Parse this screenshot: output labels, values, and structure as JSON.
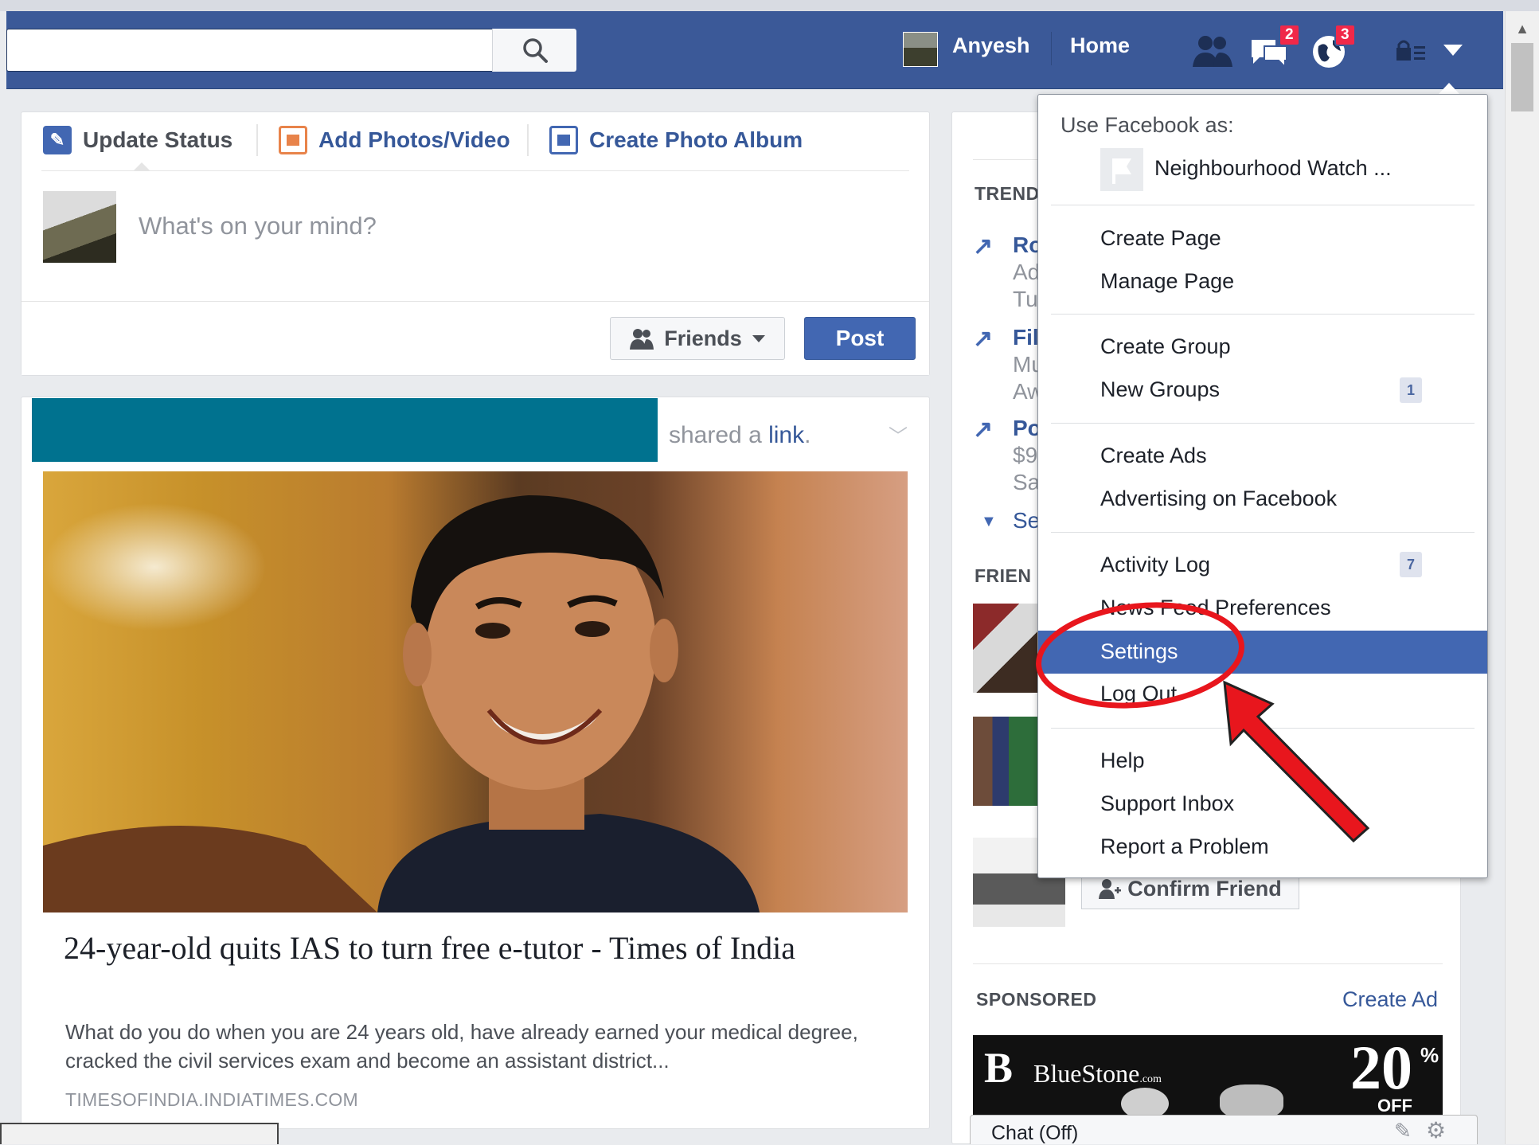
{
  "header": {
    "user_name": "Anyesh",
    "home_label": "Home",
    "notifications": {
      "messages_count": "2",
      "global_count": "3"
    }
  },
  "composer": {
    "tabs": [
      "Update Status",
      "Add Photos/Video",
      "Create Photo Album"
    ],
    "placeholder": "What's on your mind?",
    "audience_label": "Friends",
    "post_label": "Post"
  },
  "story": {
    "shared_prefix": "shared a ",
    "shared_link": "link",
    "shared_suffix": ".",
    "title": "24-year-old quits IAS to turn free e-tutor - Times of India",
    "description": "What do you do when you are 24 years old, have already earned your medical degree, cracked the civil services exam and become an assistant district...",
    "domain": "TIMESOFINDIA.INDIATIMES.COM"
  },
  "right": {
    "trending_heading": "TREND",
    "trends": [
      {
        "title": "Ro",
        "sub1": "Ad",
        "sub2": "Tu"
      },
      {
        "title": "Fil",
        "sub1": "Mu",
        "sub2": "Aw"
      },
      {
        "title": "Po",
        "sub1": "$9",
        "sub2": "Sa"
      }
    ],
    "see_more": "Se",
    "friends_heading": "FRIEN",
    "confirm_label": "Confirm Friend",
    "sponsored_heading": "SPONSORED",
    "create_ad": "Create Ad",
    "ad": {
      "brand": "BlueStone",
      "brand_suffix": ".com",
      "discount": "20",
      "percent": "%",
      "off": "OFF"
    },
    "chat_label": "Chat (Off)"
  },
  "menu": {
    "use_as_label": "Use Facebook as:",
    "page_name": "Neighbourhood Watch ...",
    "items": {
      "create_page": "Create Page",
      "manage_page": "Manage Page",
      "create_group": "Create Group",
      "new_groups": "New Groups",
      "new_groups_badge": "1",
      "create_ads": "Create Ads",
      "advertising": "Advertising on Facebook",
      "activity_log": "Activity Log",
      "activity_badge": "7",
      "news_feed_prefs": "News Feed Preferences",
      "settings": "Settings",
      "log_out": "Log Out",
      "help": "Help",
      "support_inbox": "Support Inbox",
      "report_problem": "Report a Problem"
    }
  },
  "colors": {
    "brand_blue": "#3b5998",
    "highlight_blue": "#4267b2",
    "annotation_red": "#e8161d",
    "redaction_teal": "#00728f"
  }
}
